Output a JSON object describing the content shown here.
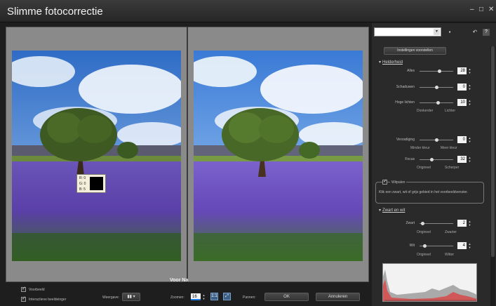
{
  "window": {
    "title": "Slimme fotocorrectie",
    "controls": {
      "minimize": "–",
      "maximize": "□",
      "close": "✕"
    }
  },
  "preview": {
    "labels": {
      "before": "Voor",
      "after": "Na"
    },
    "pixel_readout": {
      "r": "R: 0",
      "g": "G: 0",
      "b": "B: 5"
    }
  },
  "bottom": {
    "voorbeeld": "Voorbeeld",
    "interactieve": "Interactieve beeldeinger",
    "weergave_label": "Weergave:",
    "zoomen_label": "Zoomen:",
    "zoom_value": "16",
    "pannen_label": "Pannen:",
    "ok": "OK",
    "annuleren": "Annuleren"
  },
  "panel": {
    "instellingen_button": "Instellingen voorstellen",
    "helderheid": {
      "title": "Helderheid",
      "alles": {
        "label": "Alles",
        "value": "28"
      },
      "schaduwen": {
        "label": "Schaduwen",
        "value": "0"
      },
      "hoge_lichten": {
        "label": "Hoge lichten",
        "value": "10"
      },
      "hint_left": "Donkerder",
      "hint_right": "Lichter"
    },
    "verzadiging": {
      "label": "Verzadiging",
      "value": "0",
      "hint_left": "Minder kleur",
      "hint_right": "Meer kleur"
    },
    "focus": {
      "label": "Focus",
      "value": "32",
      "hint_left": "Origineel",
      "hint_right": "Scherper"
    },
    "witpalen": {
      "label": "Witpalen",
      "info": "Klik een zwart, wit of grijs gebied in het voorbeeldvenster."
    },
    "zwart_en_wit": {
      "title": "Zwart en wit",
      "zwart": {
        "label": "Zwart",
        "value": "2",
        "hint_left": "Origineel",
        "hint_right": "Zwarter"
      },
      "wit": {
        "label": "Wit",
        "value": "4",
        "hint_left": "Origineel",
        "hint_right": "Witter"
      }
    }
  }
}
